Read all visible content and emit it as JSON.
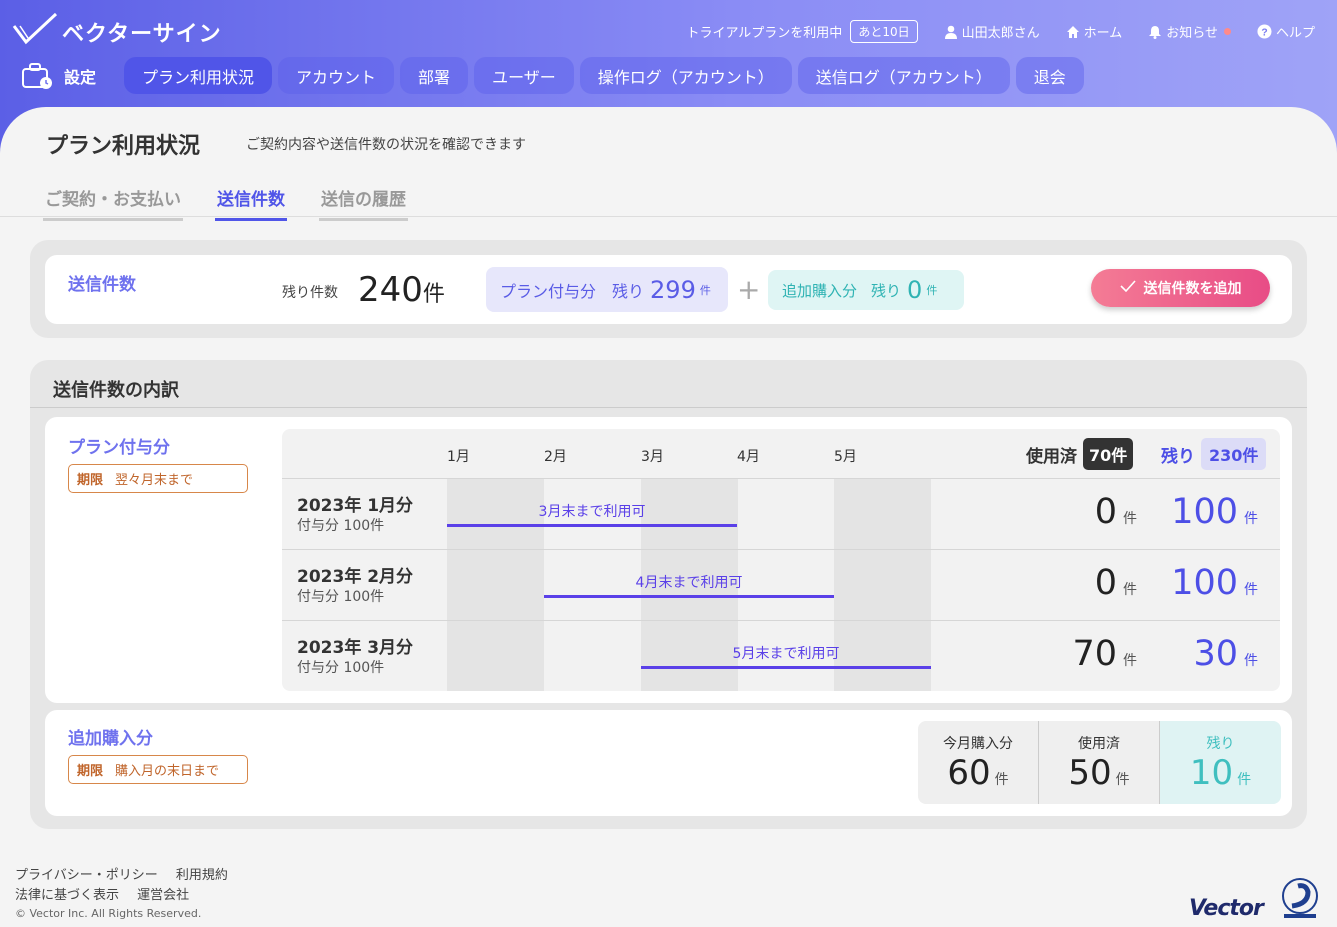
{
  "app": {
    "name": "ベクターサイン"
  },
  "topnav": {
    "trial_text": "トライアルプランを利用中",
    "trial_badge": "あと10日",
    "user": "山田太郎さん",
    "home": "ホーム",
    "notice": "お知らせ",
    "help": "ヘルプ"
  },
  "mainnav": {
    "settings": "設定",
    "tabs": [
      "プラン利用状況",
      "アカウント",
      "部署",
      "ユーザー",
      "操作ログ（アカウント）",
      "送信ログ（アカウント）",
      "退会"
    ]
  },
  "page": {
    "title": "プラン利用状況",
    "description": "ご契約内容や送信件数の状況を確認できます",
    "subtabs": [
      "ご契約・お支払い",
      "送信件数",
      "送信の履歴"
    ]
  },
  "summary": {
    "label": "送信件数",
    "remaining_label": "残り件数",
    "remaining_value": "240",
    "unit": "件",
    "plan_label": "プラン付与分",
    "plan_remaining_label": "残り",
    "plan_remaining_value": "299",
    "plus": "+",
    "extra_label": "追加購入分",
    "extra_remaining_label": "残り",
    "extra_remaining_value": "0",
    "add_button": "送信件数を追加"
  },
  "breakdown": {
    "title": "送信件数の内訳",
    "plan": {
      "label": "プラン付与分",
      "limit_tag": "期限",
      "limit_text": "翌々月末まで",
      "months": [
        "1月",
        "2月",
        "3月",
        "4月",
        "5月"
      ],
      "used_label": "使用済",
      "used_total": "70件",
      "remaining_label": "残り",
      "remaining_total": "230件",
      "rows": [
        {
          "title": "2023年 1月分",
          "sub": "付与分 100件",
          "bar_text": "3月末まで利用可",
          "used": "0",
          "remaining": "100",
          "unit": "件"
        },
        {
          "title": "2023年 2月分",
          "sub": "付与分 100件",
          "bar_text": "4月末まで利用可",
          "used": "0",
          "remaining": "100",
          "unit": "件"
        },
        {
          "title": "2023年 3月分",
          "sub": "付与分 100件",
          "bar_text": "5月末まで利用可",
          "used": "70",
          "remaining": "30",
          "unit": "件"
        }
      ]
    },
    "extra": {
      "label": "追加購入分",
      "limit_tag": "期限",
      "limit_text": "購入月の末日まで",
      "stats": [
        {
          "label": "今月購入分",
          "value": "60",
          "unit": "件"
        },
        {
          "label": "使用済",
          "value": "50",
          "unit": "件"
        },
        {
          "label": "残り",
          "value": "10",
          "unit": "件"
        }
      ]
    }
  },
  "footer": {
    "links1": [
      "プライバシー・ポリシー",
      "利用規約"
    ],
    "links2": [
      "法律に基づく表示",
      "運営会社"
    ],
    "copyright": "© Vector Inc. All Rights Reserved.",
    "brand": "Vector"
  },
  "colors": {
    "accent": "#5055e8",
    "pink": "#e84c86",
    "teal": "#3fbfbf"
  }
}
